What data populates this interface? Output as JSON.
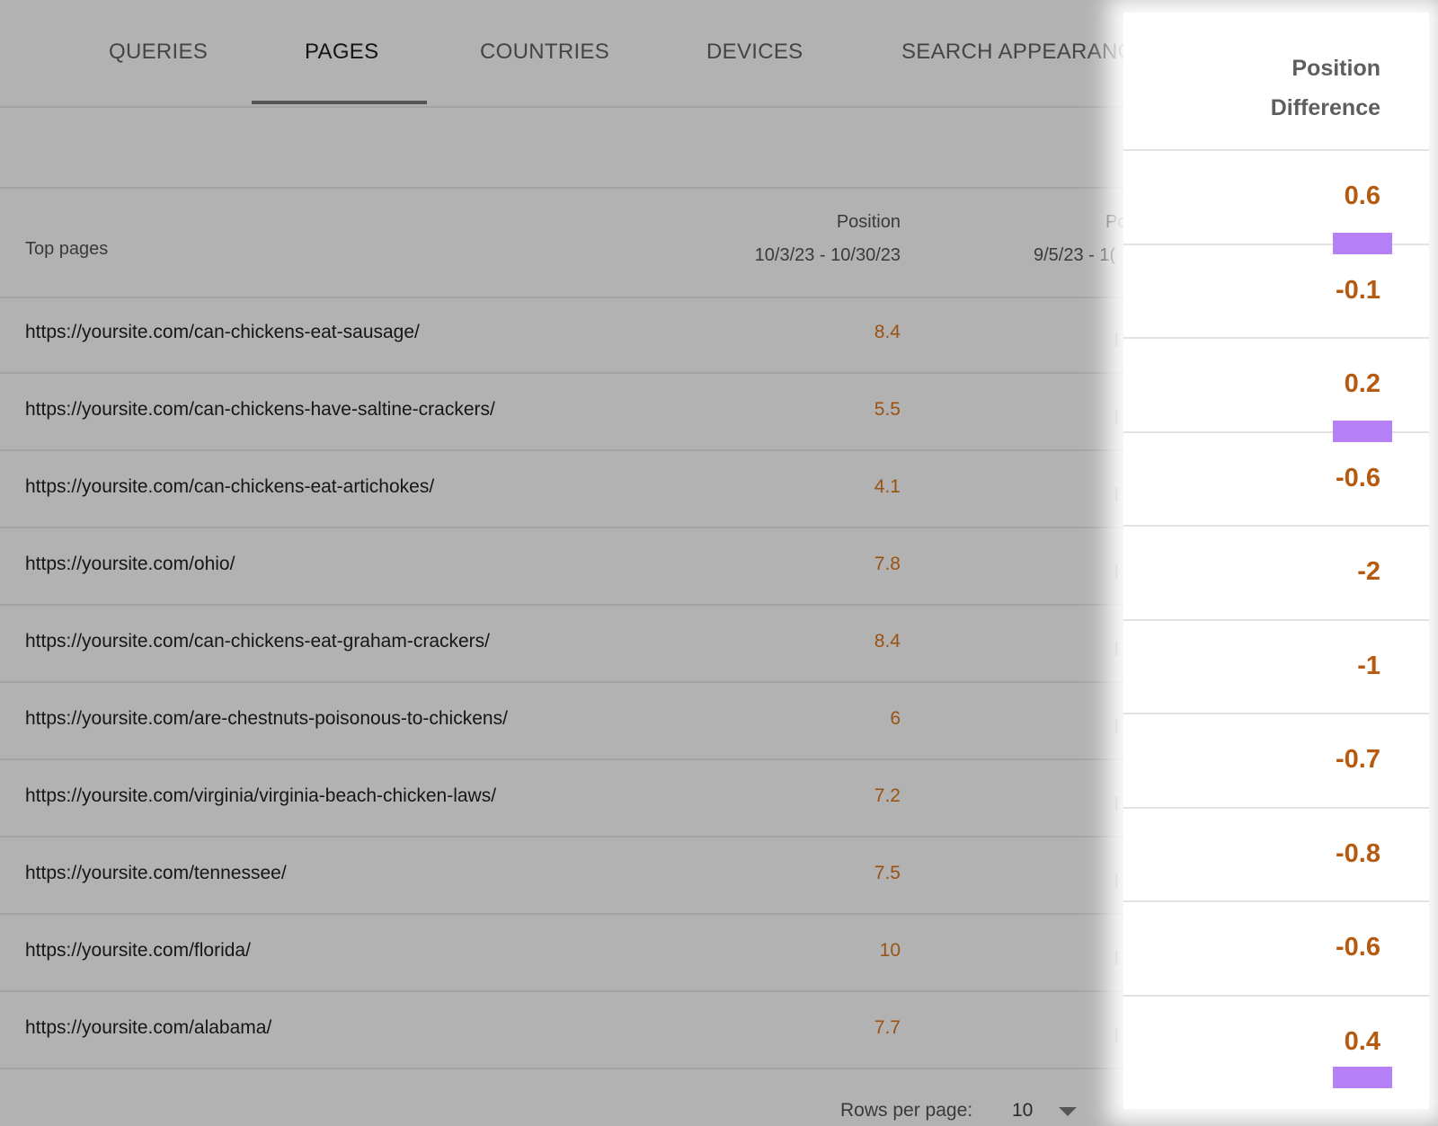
{
  "tabs": [
    {
      "label": "QUERIES",
      "active": false
    },
    {
      "label": "PAGES",
      "active": true
    },
    {
      "label": "COUNTRIES",
      "active": false
    },
    {
      "label": "DEVICES",
      "active": false
    },
    {
      "label": "SEARCH APPEARANC",
      "active": false
    }
  ],
  "table": {
    "header": {
      "top_pages": "Top pages",
      "position_label": "Position",
      "position_dates": "10/3/23 - 10/30/23",
      "prev_position_label": "Po",
      "prev_position_dates": "9/5/23 - 1("
    },
    "rows": [
      {
        "url": "https://yoursite.com/can-chickens-eat-sausage/",
        "position": "8.4"
      },
      {
        "url": "https://yoursite.com/can-chickens-have-saltine-crackers/",
        "position": "5.5"
      },
      {
        "url": "https://yoursite.com/can-chickens-eat-artichokes/",
        "position": "4.1"
      },
      {
        "url": "https://yoursite.com/ohio/",
        "position": "7.8"
      },
      {
        "url": "https://yoursite.com/can-chickens-eat-graham-crackers/",
        "position": "8.4"
      },
      {
        "url": "https://yoursite.com/are-chestnuts-poisonous-to-chickens/",
        "position": "6"
      },
      {
        "url": "https://yoursite.com/virginia/virginia-beach-chicken-laws/",
        "position": "7.2"
      },
      {
        "url": "https://yoursite.com/tennessee/",
        "position": "7.5"
      },
      {
        "url": "https://yoursite.com/florida/",
        "position": "10"
      },
      {
        "url": "https://yoursite.com/alabama/",
        "position": "7.7"
      }
    ]
  },
  "pagination": {
    "rows_per_page_label": "Rows per page:",
    "rows_per_page_value": "10"
  },
  "highlight": {
    "title_line1": "Position",
    "title_line2": "Difference",
    "diffs": [
      {
        "value": "0.6",
        "marked": true
      },
      {
        "value": "-0.1",
        "marked": false
      },
      {
        "value": "0.2",
        "marked": true
      },
      {
        "value": "-0.6",
        "marked": false
      },
      {
        "value": "-2",
        "marked": false
      },
      {
        "value": "-1",
        "marked": false
      },
      {
        "value": "-0.7",
        "marked": false
      },
      {
        "value": "-0.8",
        "marked": false
      },
      {
        "value": "-0.6",
        "marked": false
      },
      {
        "value": "0.4",
        "marked": true
      }
    ],
    "value_color": "#b55a0e",
    "marker_color": "#b57ff5"
  }
}
